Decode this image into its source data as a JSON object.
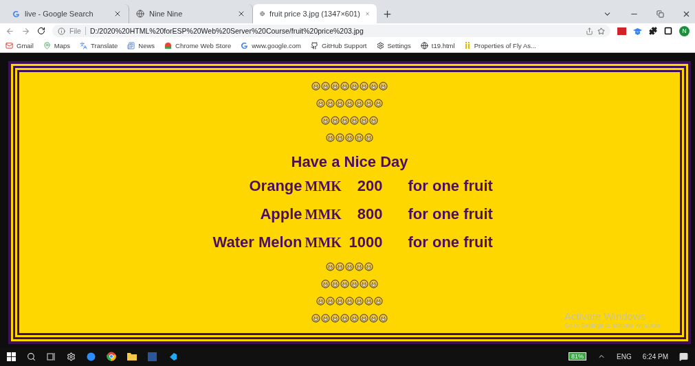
{
  "tabs": [
    {
      "title": "live - Google Search",
      "kind": "google",
      "selected": false
    },
    {
      "title": "Nine Nine",
      "kind": "globe",
      "selected": false
    },
    {
      "title": "fruit price 3.jpg (1347×601)",
      "kind": "globe",
      "selected": true
    }
  ],
  "address": {
    "scheme": "File",
    "url": "D:/2020%20HTML%20forESP%20Web%20Server%20Course/fruit%20price%203.jpg"
  },
  "profile": "N",
  "bookmarks": [
    {
      "label": "Gmail",
      "kind": "gmail"
    },
    {
      "label": "Maps",
      "kind": "maps"
    },
    {
      "label": "Translate",
      "kind": "translate"
    },
    {
      "label": "News",
      "kind": "news"
    },
    {
      "label": "Chrome Web Store",
      "kind": "store"
    },
    {
      "label": "www.google.com",
      "kind": "google"
    },
    {
      "label": "GitHub Support",
      "kind": "github"
    },
    {
      "label": "Settings",
      "kind": "gear"
    },
    {
      "label": "t19.html",
      "kind": "globe"
    },
    {
      "label": "Properties of Fly As...",
      "kind": "ij"
    }
  ],
  "image": {
    "top_smileys": [
      {
        "faces": [
          {
            "kind": "grin"
          },
          {
            "kind": "grin"
          },
          {
            "kind": "grin"
          },
          {
            "kind": "grin"
          },
          {
            "kind": "grin"
          },
          {
            "kind": "grin"
          },
          {
            "kind": "grin"
          },
          {
            "kind": "grin"
          }
        ]
      },
      {
        "faces": [
          {
            "kind": "grin"
          },
          {
            "kind": "grin"
          },
          {
            "kind": "grin"
          },
          {
            "kind": "grin"
          },
          {
            "kind": "grin"
          },
          {
            "kind": "grin"
          },
          {
            "kind": "grin"
          }
        ]
      },
      {
        "faces": [
          {
            "kind": "grin"
          },
          {
            "kind": "grin"
          },
          {
            "kind": "grin"
          },
          {
            "kind": "grin"
          },
          {
            "kind": "grin"
          },
          {
            "kind": "grin"
          }
        ]
      },
      {
        "faces": [
          {
            "kind": "grin"
          },
          {
            "kind": "grin"
          },
          {
            "kind": "grin"
          },
          {
            "kind": "grin"
          },
          {
            "kind": "grin"
          }
        ]
      }
    ],
    "heading": "Have a Nice Day",
    "prices": [
      {
        "fruit": "Orange",
        "currency": "MMK",
        "price": "200",
        "unit": "for one fruit"
      },
      {
        "fruit": "Apple",
        "currency": "MMK",
        "price": "800",
        "unit": "for one fruit"
      },
      {
        "fruit": "Water Melon",
        "currency": "MMK",
        "price": "1000",
        "unit": "for one fruit"
      }
    ],
    "bottom_smileys": [
      {
        "faces": [
          {
            "kind": "grin"
          },
          {
            "kind": "grin"
          },
          {
            "kind": "grin"
          },
          {
            "kind": "grin"
          },
          {
            "kind": "grin"
          }
        ]
      },
      {
        "faces": [
          {
            "kind": "grin"
          },
          {
            "kind": "grin"
          },
          {
            "kind": "grin"
          },
          {
            "kind": "grin"
          },
          {
            "kind": "grin"
          },
          {
            "kind": "grin"
          }
        ]
      },
      {
        "faces": [
          {
            "kind": "grin"
          },
          {
            "kind": "grin"
          },
          {
            "kind": "grin"
          },
          {
            "kind": "grin"
          },
          {
            "kind": "grin"
          },
          {
            "kind": "grin"
          },
          {
            "kind": "grin"
          }
        ]
      },
      {
        "faces": [
          {
            "kind": "grin"
          },
          {
            "kind": "grin"
          },
          {
            "kind": "grin"
          },
          {
            "kind": "grin"
          },
          {
            "kind": "grin"
          },
          {
            "kind": "grin"
          },
          {
            "kind": "grin"
          },
          {
            "kind": "grin"
          }
        ]
      }
    ]
  },
  "activation": {
    "title": "Activate Windows",
    "text": "Go to Settings to activate Windows."
  },
  "taskbar": {
    "battery": "81%",
    "language": "ENG",
    "time": "6:24 PM"
  }
}
